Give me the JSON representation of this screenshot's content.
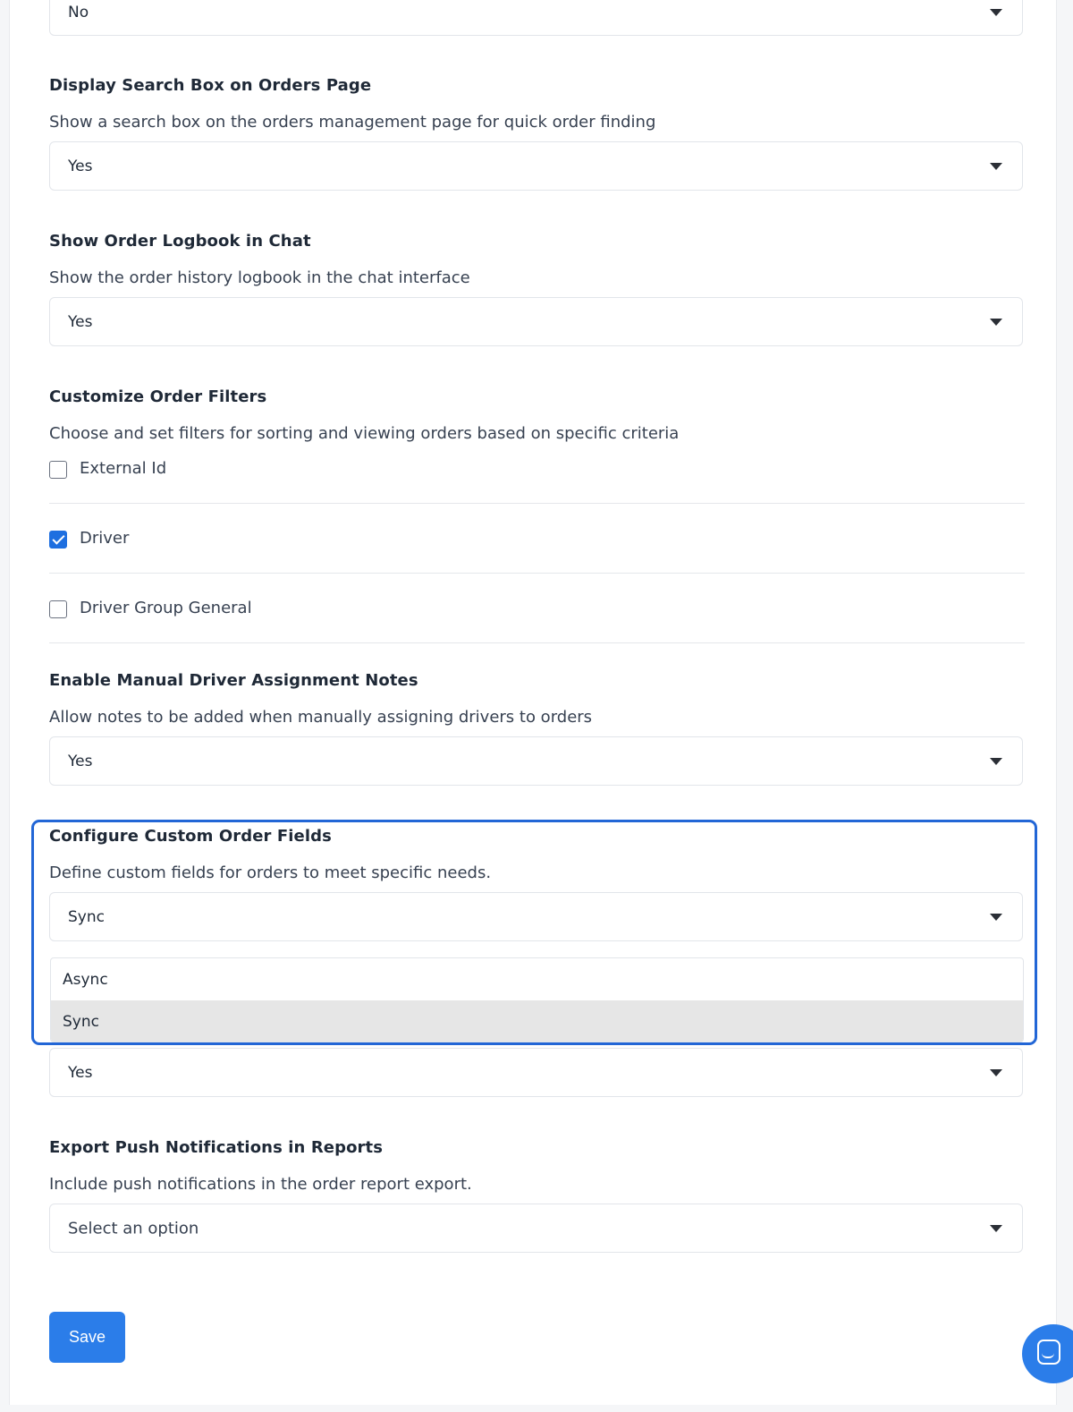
{
  "settings": {
    "top_select": {
      "value": "No"
    },
    "search_box": {
      "title": "Display Search Box on Orders Page",
      "description": "Show a search box on the orders management page for quick order finding",
      "value": "Yes"
    },
    "logbook": {
      "title": "Show Order Logbook in Chat",
      "description": "Show the order history logbook in the chat interface",
      "value": "Yes"
    },
    "filters": {
      "title": "Customize Order Filters",
      "description": "Choose and set filters for sorting and viewing orders based on specific criteria",
      "options": [
        {
          "label": "External Id",
          "checked": false
        },
        {
          "label": "Driver",
          "checked": true
        },
        {
          "label": "Driver Group General",
          "checked": false
        }
      ]
    },
    "assignment_notes": {
      "title": "Enable Manual Driver Assignment Notes",
      "description": "Allow notes to be added when manually assigning drivers to orders",
      "value": "Yes"
    },
    "custom_fields": {
      "title": "Configure Custom Order Fields",
      "description": "Define custom fields for orders to meet specific needs.",
      "value": "Sync",
      "options": [
        "Async",
        "Sync"
      ],
      "highlighted_option": "Sync"
    },
    "hidden_setting": {
      "value": "Yes"
    },
    "push_notifications": {
      "title": "Export Push Notifications in Reports",
      "description": "Include push notifications in the order report export.",
      "placeholder": "Select an option"
    }
  },
  "actions": {
    "save_label": "Save"
  },
  "colors": {
    "accent": "#2b7de9",
    "focus_border": "#2266d6",
    "selected_option_bg": "#e6e6e6"
  },
  "icons": {
    "select_caret": "caret-down-icon",
    "chat_launcher": "chat-icon"
  }
}
